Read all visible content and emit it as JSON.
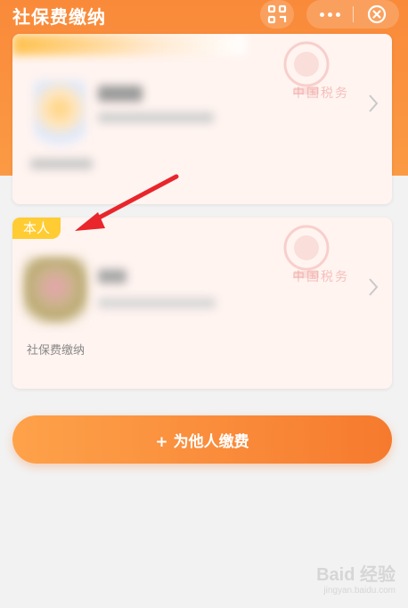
{
  "header": {
    "title": "社保费缴纳",
    "icons": [
      "scan-icon",
      "more-icon",
      "close-icon"
    ]
  },
  "card_self": {
    "tag": "本人",
    "service_label": "社保费缴纳",
    "watermark": "中国税务"
  },
  "card_top": {
    "watermark": "中国税务"
  },
  "pay_for_others": {
    "label": "+ 为他人缴费"
  },
  "watermark_brand": {
    "text": "Baid 经验",
    "sub": "jingyan.baidu.com"
  },
  "colors": {
    "accent": "#f98a3a",
    "tag": "#ffcc33",
    "card_bg": "#fff4f0",
    "page_bg": "#f2f2f2",
    "annotation_arrow": "#e8262b"
  }
}
